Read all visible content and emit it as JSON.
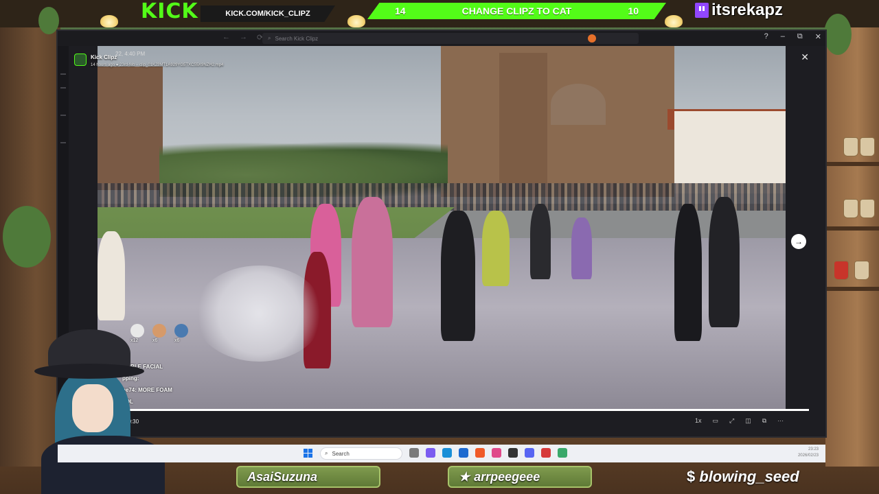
{
  "overlay": {
    "kick_logo": "KICK",
    "kick_url": "KICK.COM/KICK_CLIPZ",
    "poll": {
      "left_count": "14",
      "title": "CHANGE CLIPZ TO CAT",
      "right_count": "10"
    },
    "handle": "itsrekapz",
    "colors": {
      "kick_green": "#53fc18",
      "twitch_purple": "#9146ff"
    }
  },
  "window": {
    "search_placeholder": "Search Kick Clipz",
    "controls": {
      "help": "?",
      "minimize": "–",
      "maximize": "⧉",
      "close": "✕"
    }
  },
  "clip": {
    "channel_name": "Kick Clipz",
    "date": "22, 4:40 PM",
    "subtitle": "14 hours ago ● 23rd-feb – clip_01KJ3MT1A929YG5TXC55X9NZH2.mp4",
    "time": "/ 0:30",
    "progress_fraction": 1.0,
    "close_icon": "close-icon",
    "next_icon": "arrow-right-icon",
    "player_controls": [
      "1x",
      "▭",
      "⤢",
      "◫",
      "⧉",
      "···"
    ]
  },
  "chat": {
    "emotes": [
      {
        "icon": "skull-emote",
        "count": "x12",
        "color": "#e8e8e8"
      },
      {
        "icon": "face-emote",
        "count": "x6",
        "color": "#d69a6a"
      },
      {
        "icon": "alien-emote",
        "count": "x6",
        "color": "#4a7ab0"
      }
    ],
    "lines": [
      "OUBLE FACIAL",
      "pping:",
      "ge74: MORE FOAM",
      "LOL"
    ]
  },
  "taskbar": {
    "search_label": "Search",
    "clock_time": "23:23",
    "clock_date": "2026/02/23",
    "icons": [
      {
        "name": "files-icon",
        "color": "#7a7a7a"
      },
      {
        "name": "copilot-icon",
        "color": "#7b5cf0"
      },
      {
        "name": "edge-icon",
        "color": "#1a8fd8"
      },
      {
        "name": "store-icon",
        "color": "#1e6ad0"
      },
      {
        "name": "brave-icon",
        "color": "#f05a28"
      },
      {
        "name": "heart-icon",
        "color": "#e04a8a"
      },
      {
        "name": "app-icon",
        "color": "#333333"
      },
      {
        "name": "discord-icon",
        "color": "#5865f2"
      },
      {
        "name": "record-icon",
        "color": "#d63a3a"
      },
      {
        "name": "overlay-icon",
        "color": "#3aa86a"
      }
    ]
  },
  "plates": {
    "left": "AsaiSuzuna",
    "middle": "arrpeegeee",
    "right": "blowing_seed"
  }
}
